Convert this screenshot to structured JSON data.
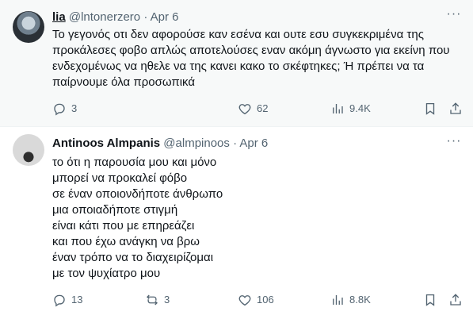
{
  "tweets": [
    {
      "name": "lia",
      "handle": "@lntonerzero",
      "separator": "·",
      "date": "Apr 6",
      "more": "···",
      "text_lines": [
        "Το γεγονός οτι δεν αφορούσε καν εσένα και ουτε εσυ συγκεκριμένα της",
        "προκάλεσες φοβο απλώς αποτελούσες εναν ακόμη άγνωστο για εκείνη που",
        "ενδεχομένως να ηθελε να της κανει κακο το σκέφτηκες; Ή πρέπει να τα",
        "παίρνουμε όλα προσωπικά"
      ],
      "actions": {
        "replies": "3",
        "reposts": "",
        "likes": "62",
        "views": "9.4K"
      }
    },
    {
      "name": "Antinoos Almpanis",
      "handle": "@almpinoos",
      "separator": "·",
      "date": "Apr 6",
      "more": "···",
      "text_lines": [
        "το ότι η παρουσία μου και μόνο",
        "μπορεί να προκαλεί φόβο",
        "σε έναν οποιονδήποτε άνθρωπο",
        "μια οποιαδήποτε στιγμή",
        "είναι κάτι που με επηρεάζει",
        "και που έχω ανάγκη να βρω",
        "έναν τρόπο να το διαχειρίζομαι",
        "με τον ψυχίατρο μου"
      ],
      "actions": {
        "replies": "13",
        "reposts": "3",
        "likes": "106",
        "views": "8.8K"
      }
    }
  ],
  "icons": {
    "reply": "reply-icon",
    "repost": "repost-icon",
    "like": "heart-icon",
    "views": "views-chart-icon",
    "bookmark": "bookmark-icon",
    "share": "share-icon",
    "more": "more-icon"
  },
  "colors": {
    "text": "#0f1419",
    "secondary": "#536471",
    "highlight_bg": "#f7f9f9",
    "border": "#eff3f4"
  }
}
